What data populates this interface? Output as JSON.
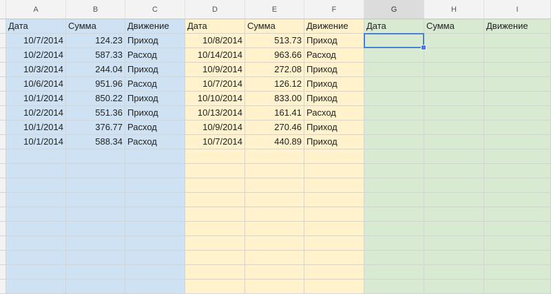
{
  "columns": [
    "A",
    "B",
    "C",
    "D",
    "E",
    "F",
    "G",
    "H",
    "I"
  ],
  "selected_column": "G",
  "selected_cell": "G2",
  "header_row": [
    "Дата",
    "Сумма",
    "Движение",
    "Дата",
    "Сумма",
    "Движение",
    "Дата",
    "Сумма",
    "Движение"
  ],
  "rows": [
    [
      "10/7/2014",
      "124.23",
      "Приход",
      "10/8/2014",
      "513.73",
      "Приход",
      "",
      "",
      ""
    ],
    [
      "10/2/2014",
      "587.33",
      "Расход",
      "10/14/2014",
      "963.66",
      "Расход",
      "",
      "",
      ""
    ],
    [
      "10/3/2014",
      "244.04",
      "Приход",
      "10/9/2014",
      "272.08",
      "Приход",
      "",
      "",
      ""
    ],
    [
      "10/6/2014",
      "951.96",
      "Расход",
      "10/7/2014",
      "126.12",
      "Приход",
      "",
      "",
      ""
    ],
    [
      "10/1/2014",
      "850.22",
      "Приход",
      "10/10/2014",
      "833.00",
      "Приход",
      "",
      "",
      ""
    ],
    [
      "10/2/2014",
      "551.36",
      "Приход",
      "10/13/2014",
      "161.41",
      "Расход",
      "",
      "",
      ""
    ],
    [
      "10/1/2014",
      "376.77",
      "Расход",
      "10/9/2014",
      "270.46",
      "Приход",
      "",
      "",
      ""
    ],
    [
      "10/1/2014",
      "588.34",
      "Расход",
      "10/7/2014",
      "440.89",
      "Приход",
      "",
      "",
      ""
    ]
  ],
  "block_colors": {
    "block1": "#cfe2f3",
    "block2": "#fff2cc",
    "block3": "#d9ead3",
    "selection": "#4a7fd8"
  }
}
